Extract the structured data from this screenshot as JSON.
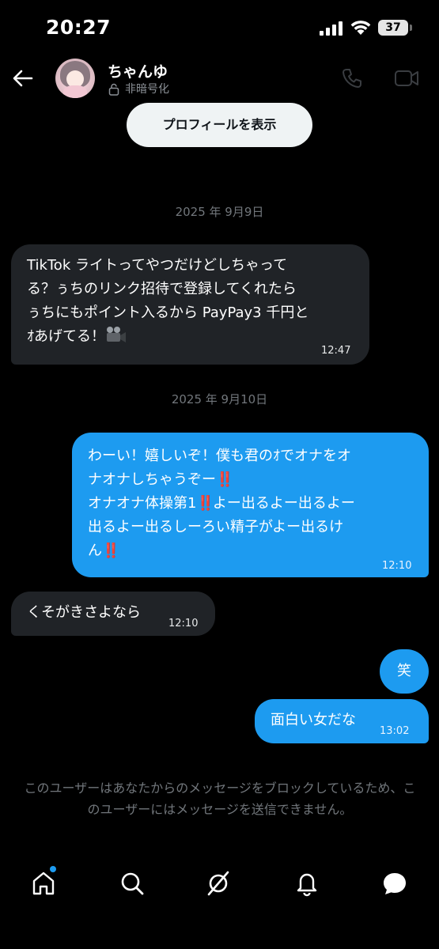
{
  "status_bar": {
    "time": "20:27",
    "battery": "37"
  },
  "header": {
    "name": "ちゃんゆ",
    "encryption": "非暗号化",
    "icons": [
      "back-arrow-icon",
      "lock-icon",
      "phone-icon",
      "video-icon"
    ]
  },
  "profile_button": "プロフィールを表示",
  "dates": [
    "2025 年 9月9日",
    "2025 年 9月10日"
  ],
  "messages": [
    {
      "direction": "in",
      "lines": [
        "TikTok ライトってやつだけどしちゃって",
        "る？ぅちのリンク招待で登録してくれたら",
        "ぅちにもポイント入るから PayPay3 千円と",
        "ｵあげてる！"
      ],
      "emoji": "movie-camera",
      "time": "12:47"
    },
    {
      "direction": "out",
      "lines": [
        "わーい！嬉しいぞ！僕も君のｵでオナをオ",
        "ナオナしちゃうぞー",
        "オナオナ体操第1",
        "よー出るよー出るよー",
        "出るよー出るしーろい精子がよー出るけ",
        "ん"
      ],
      "emoji": "‼️",
      "time": "12:10"
    },
    {
      "direction": "in",
      "text": "くそがきさよなら",
      "time": "12:10"
    },
    {
      "direction": "out",
      "text": "笑"
    },
    {
      "direction": "out",
      "text": "面白い女だな",
      "time": "13:02"
    }
  ],
  "notice": "このユーザーはあなたからのメッセージをブロックしているため、このユーザーにはメッセージを送信できません。",
  "bottom_nav": [
    "home-icon",
    "search-icon",
    "grok-icon",
    "notifications-icon",
    "messages-icon"
  ],
  "colors": {
    "outgoing": "#1d9bf0",
    "incoming": "#202327",
    "background": "#000000",
    "muted": "#71767b"
  }
}
